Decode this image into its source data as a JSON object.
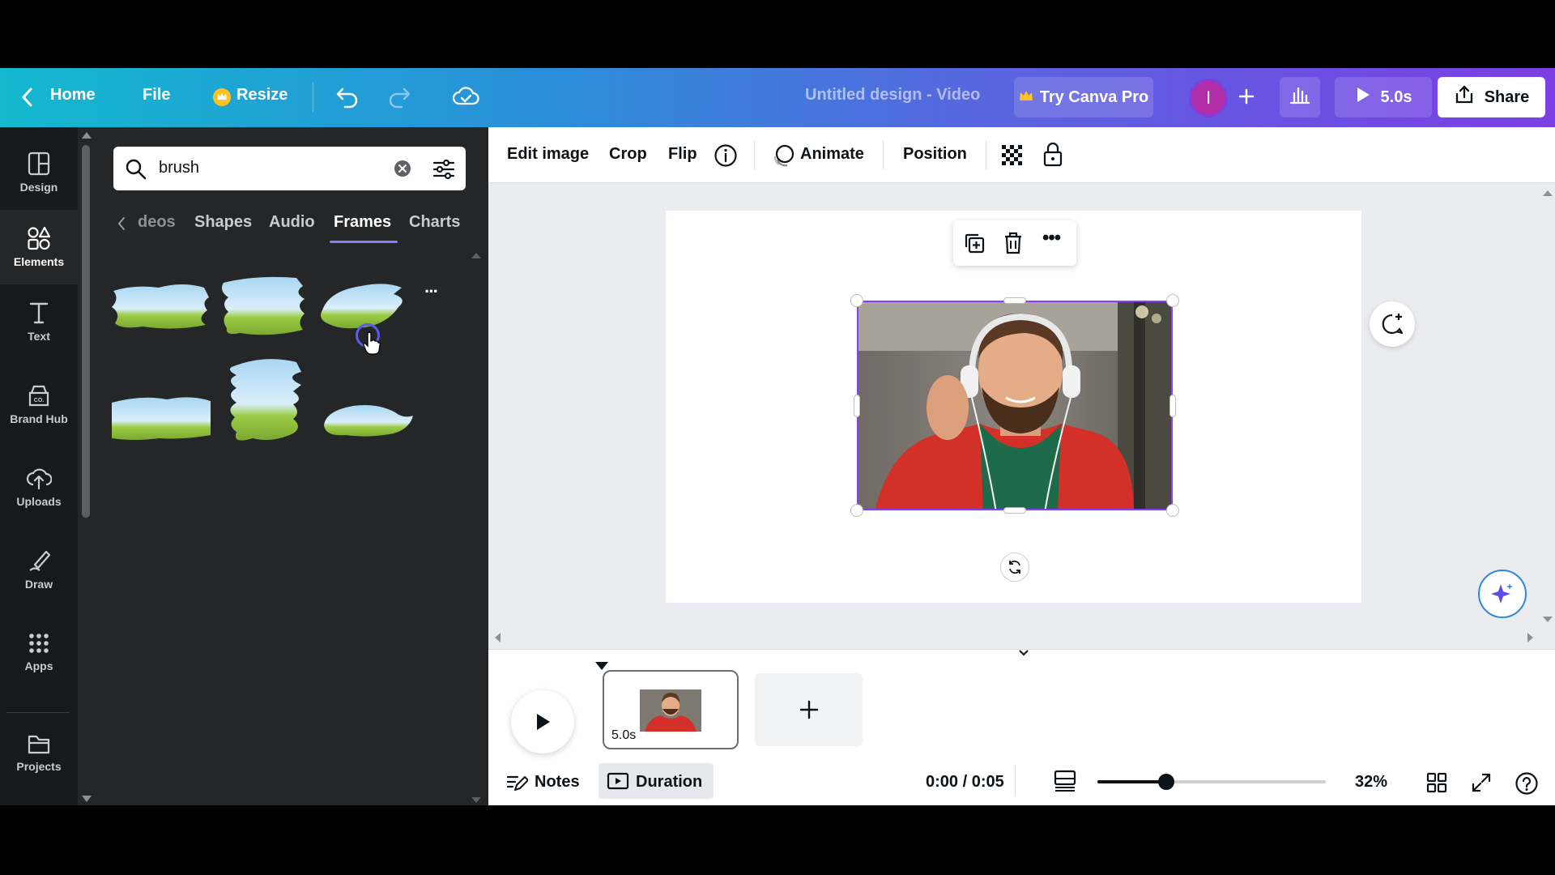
{
  "topbar": {
    "home": "Home",
    "file": "File",
    "resize": "Resize",
    "title": "Untitled design - Video",
    "try_pro": "Try Canva Pro",
    "avatar_initial": "I",
    "play_duration": "5.0s",
    "share": "Share"
  },
  "rail": {
    "items": [
      {
        "label": "Design",
        "icon": "design-icon"
      },
      {
        "label": "Elements",
        "icon": "elements-icon"
      },
      {
        "label": "Text",
        "icon": "text-icon"
      },
      {
        "label": "Brand Hub",
        "icon": "brand-hub-icon"
      },
      {
        "label": "Uploads",
        "icon": "uploads-icon"
      },
      {
        "label": "Draw",
        "icon": "draw-icon"
      },
      {
        "label": "Apps",
        "icon": "apps-icon"
      },
      {
        "label": "Projects",
        "icon": "projects-icon"
      }
    ],
    "active": "Elements"
  },
  "panel": {
    "search_value": "brush",
    "categories": [
      "deos",
      "Shapes",
      "Audio",
      "Frames",
      "Charts"
    ],
    "active_category": "Frames"
  },
  "context_toolbar": {
    "edit_image": "Edit image",
    "crop": "Crop",
    "flip": "Flip",
    "animate": "Animate",
    "position": "Position"
  },
  "timeline": {
    "clip_duration": "5.0s",
    "notes": "Notes",
    "duration": "Duration",
    "time": "0:00 / 0:05",
    "zoom": "32%",
    "zoom_level": 0.3
  },
  "colors": {
    "accent": "#7d2ae8",
    "selection": "#8b3dff",
    "underline": "#8b7cf6"
  }
}
